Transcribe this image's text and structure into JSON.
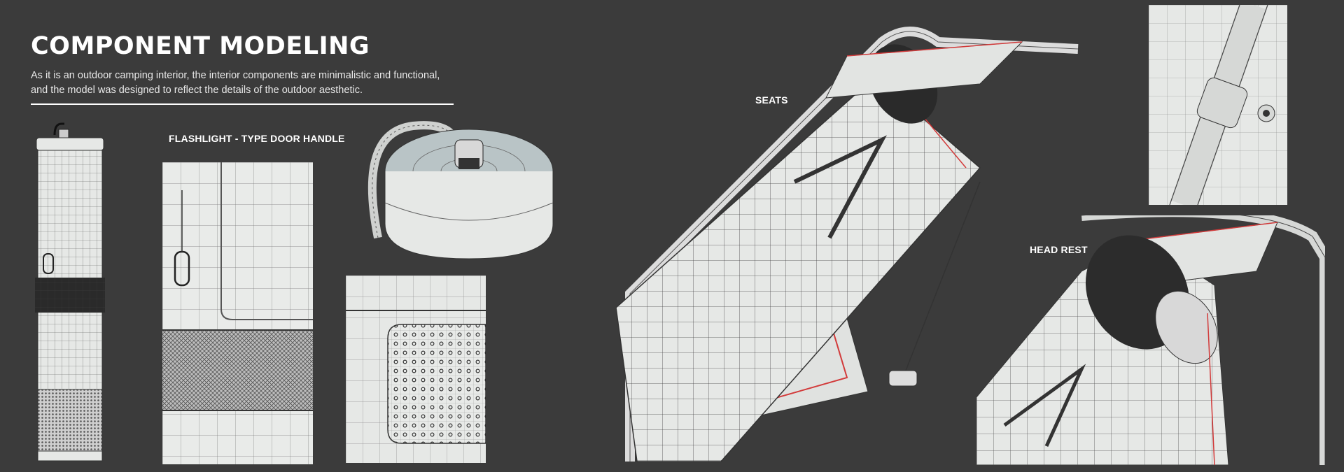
{
  "header": {
    "title": "COMPONENT MODELING",
    "description_line1": "As it is an outdoor camping interior, the interior components are minimalistic and functional,",
    "description_line2": "and the model was designed to reflect the details of the outdoor aesthetic."
  },
  "labels": {
    "flashlight": "FLASHLIGHT - TYPE DOOR HANDLE",
    "seats": "SEATS",
    "head_rest": "HEAD REST"
  },
  "colors": {
    "background": "#3b3b3b",
    "model_surface": "#e6e8e6",
    "wire": "#3a3a3a",
    "accent_red": "#d23a3a"
  }
}
